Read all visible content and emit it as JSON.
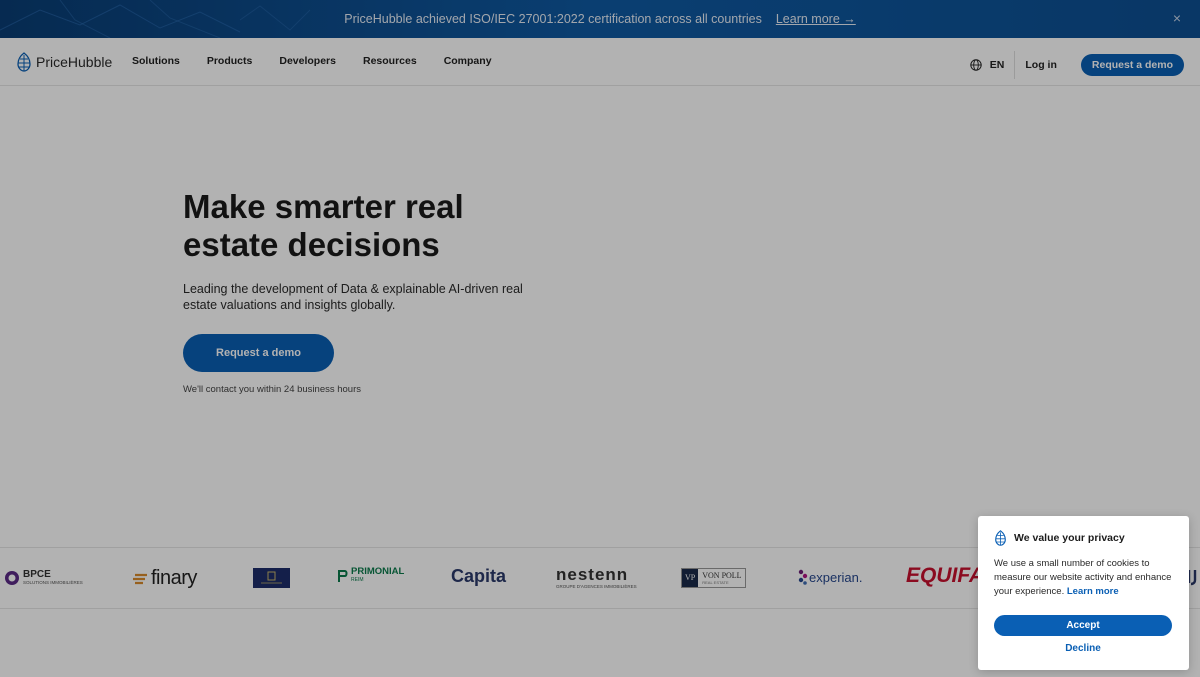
{
  "banner": {
    "message": "PriceHubble achieved ISO/IEC 27001:2022 certification across all countries",
    "link": "Learn more →",
    "close": "×"
  },
  "nav": {
    "logo_text": "PriceHubble",
    "links": [
      "Solutions",
      "Products",
      "Developers",
      "Resources",
      "Company"
    ],
    "language": "EN",
    "login": "Log in",
    "demo": "Request a demo"
  },
  "hero": {
    "title": "Make smarter real estate decisions",
    "subtitle": "Leading the development of Data & explainable AI-driven real estate valuations and insights globally.",
    "cta": "Request a demo",
    "note": "We'll contact you within 24 business hours"
  },
  "logos": {
    "bpce": "BPCE",
    "bpce_sub": "SOLUTIONS IMMOBILIÈRES",
    "finary": "finary",
    "primonial": "PRIMONIAL",
    "primonial_sub": "REIM",
    "capita": "Capita",
    "nestenn": "nestenn",
    "nestenn_sub": "GROUPE D'AGENCES IMMOBILIÈRES",
    "vonpoll_mark": "VP",
    "vonpoll": "VON POLL",
    "vonpoll_sub": "REAL ESTATE",
    "experian": "experian.",
    "equifax": "EQUIFA"
  },
  "cookie": {
    "title": "We value your privacy",
    "body": "We use a small number of cookies to measure our website activity and enhance your experience.",
    "learn_more": "Learn more",
    "accept": "Accept",
    "decline": "Decline"
  },
  "colors": {
    "brand_blue": "#0a5fb4",
    "banner_blue": "#0d4f92",
    "equifax_red": "#c8102e",
    "primonial_green": "#0b7a4b"
  }
}
